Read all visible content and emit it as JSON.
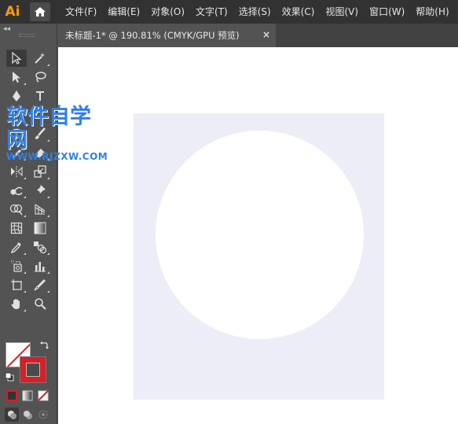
{
  "app": {
    "logo": "Ai",
    "home_icon": "home-icon"
  },
  "menu": {
    "items": [
      "文件(F)",
      "编辑(E)",
      "对象(O)",
      "文字(T)",
      "选择(S)",
      "效果(C)",
      "视图(V)",
      "窗口(W)",
      "帮助(H)"
    ]
  },
  "document_tab": {
    "title": "未标题-1* @ 190.81% (CMYK/GPU 预览)",
    "close": "×"
  },
  "toolbar": {
    "collapse": "◂◂",
    "tools": [
      "selection-tool",
      "magic-wand-tool",
      "direct-selection-tool",
      "lasso-tool",
      "pen-tool",
      "type-tool",
      "ellipse-tool",
      "paintbrush-tool",
      "pencil-tool",
      "eraser-tool",
      "reflect-tool",
      "scale-tool",
      "warp-tool",
      "puppet-warp-tool",
      "shape-builder-tool",
      "perspective-grid-tool",
      "mesh-tool",
      "gradient-tool",
      "eyedropper-tool",
      "blend-tool",
      "symbol-sprayer-tool",
      "column-graph-tool",
      "artboard-tool",
      "slice-tool",
      "hand-tool",
      "zoom-tool"
    ],
    "fill_color": "#ffffff",
    "stroke_color": "#d71f26"
  },
  "watermark": {
    "title": "软件自学网",
    "url": "WWW.RJZXW.COM",
    "color": "#2f7fe8"
  },
  "canvas": {
    "background": "#ffffff",
    "artboard_color": "#ededf7",
    "shape": "circle",
    "shape_fill": "#ffffff"
  }
}
